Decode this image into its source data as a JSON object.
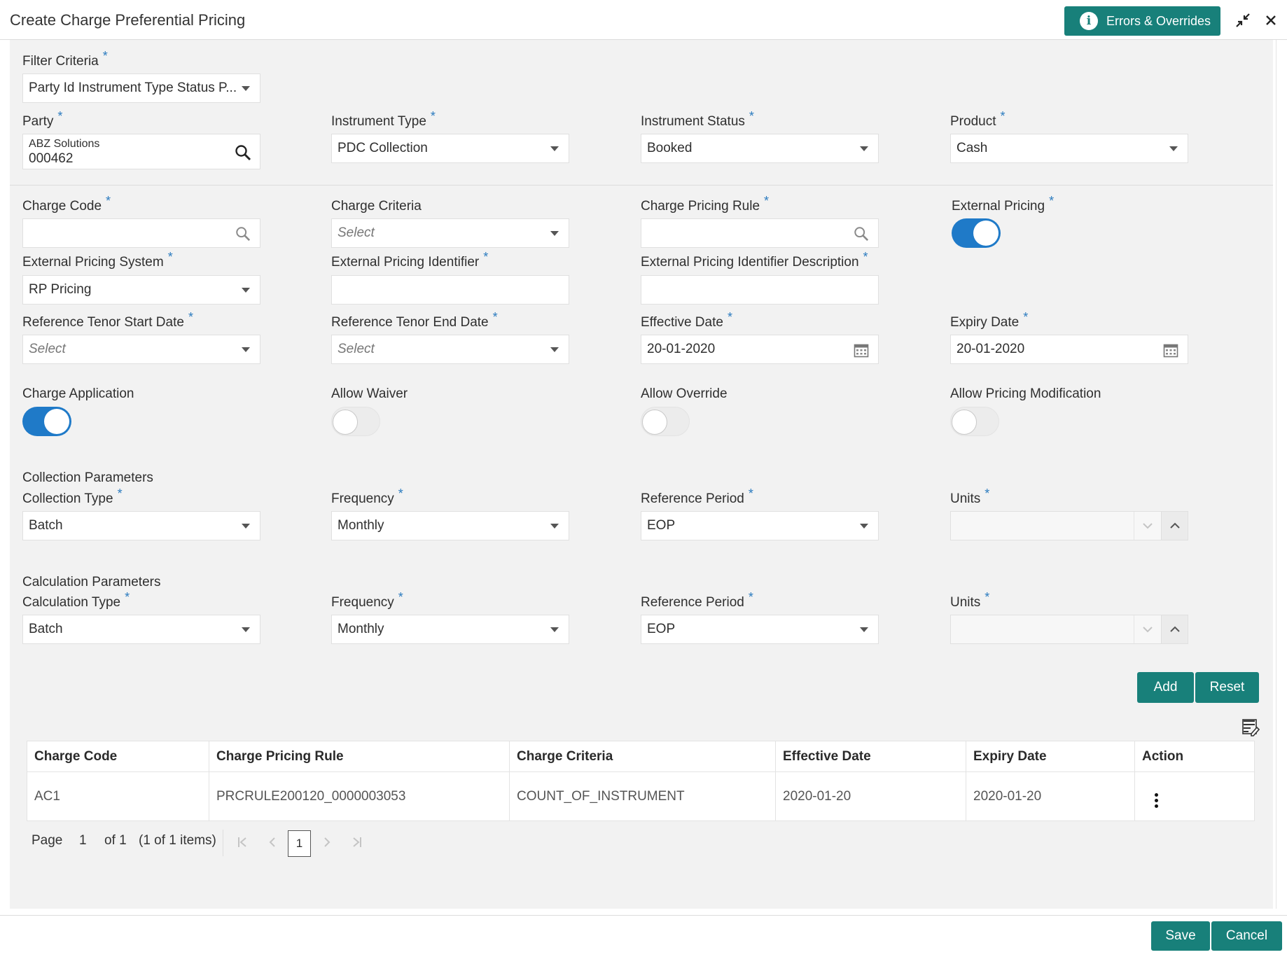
{
  "header": {
    "title": "Create Charge Preferential Pricing",
    "errors_button": "Errors & Overrides",
    "info_icon_glyph": "i"
  },
  "filter": {
    "label": "Filter Criteria",
    "value": "Party Id Instrument Type Status P..."
  },
  "party": {
    "label": "Party",
    "name": "ABZ Solutions",
    "id": "000462"
  },
  "instrument_type": {
    "label": "Instrument Type",
    "value": "PDC Collection"
  },
  "instrument_status": {
    "label": "Instrument Status",
    "value": "Booked"
  },
  "product": {
    "label": "Product",
    "value": "Cash"
  },
  "charge_code": {
    "label": "Charge Code",
    "value": ""
  },
  "charge_criteria": {
    "label": "Charge Criteria",
    "placeholder": "Select"
  },
  "charge_pricing_rule": {
    "label": "Charge Pricing Rule",
    "value": ""
  },
  "external_pricing": {
    "label": "External Pricing",
    "on": true
  },
  "external_pricing_system": {
    "label": "External Pricing System",
    "value": "RP Pricing"
  },
  "external_pricing_identifier": {
    "label": "External Pricing Identifier",
    "value": ""
  },
  "external_pricing_identifier_desc": {
    "label": "External Pricing Identifier Description",
    "value": ""
  },
  "ref_tenor_start": {
    "label": "Reference Tenor Start Date",
    "placeholder": "Select"
  },
  "ref_tenor_end": {
    "label": "Reference Tenor End Date",
    "placeholder": "Select"
  },
  "effective_date": {
    "label": "Effective Date",
    "value": "20-01-2020"
  },
  "expiry_date": {
    "label": "Expiry Date",
    "value": "20-01-2020"
  },
  "toggles": {
    "charge_application": {
      "label": "Charge Application",
      "on": true
    },
    "allow_waiver": {
      "label": "Allow Waiver",
      "on": false
    },
    "allow_override": {
      "label": "Allow Override",
      "on": false
    },
    "allow_pricing_modification": {
      "label": "Allow Pricing Modification",
      "on": false
    }
  },
  "collection": {
    "section_label": "Collection Parameters",
    "type_label": "Collection Type",
    "type_value": "Batch",
    "frequency_label": "Frequency",
    "frequency_value": "Monthly",
    "ref_period_label": "Reference Period",
    "ref_period_value": "EOP",
    "units_label": "Units",
    "units_value": ""
  },
  "calculation": {
    "section_label": "Calculation Parameters",
    "type_label": "Calculation Type",
    "type_value": "Batch",
    "frequency_label": "Frequency",
    "frequency_value": "Monthly",
    "ref_period_label": "Reference Period",
    "ref_period_value": "EOP",
    "units_label": "Units",
    "units_value": ""
  },
  "actions": {
    "add": "Add",
    "reset": "Reset"
  },
  "table": {
    "headers": [
      "Charge Code",
      "Charge Pricing Rule",
      "Charge Criteria",
      "Effective Date",
      "Expiry Date",
      "Action"
    ],
    "rows": [
      [
        "AC1",
        "PRCRULE200120_0000003053",
        "COUNT_OF_INSTRUMENT",
        "2020-01-20",
        "2020-01-20"
      ]
    ]
  },
  "pagination": {
    "page_label": "Page",
    "page_value": "1",
    "of_label": "of 1",
    "items_label": "(1 of 1 items)",
    "current": "1"
  },
  "footer": {
    "save": "Save",
    "cancel": "Cancel"
  },
  "colors": {
    "accent": "#18807a",
    "toggle_on": "#1f7ac8",
    "required": "#2b7bbf"
  }
}
